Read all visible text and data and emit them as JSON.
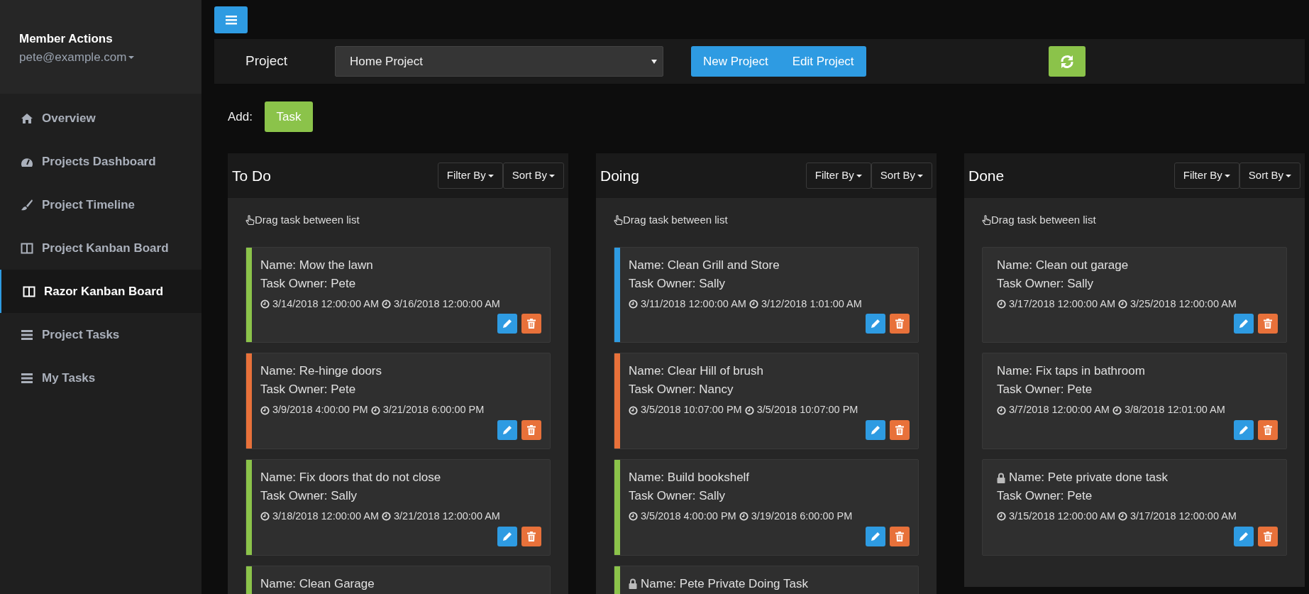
{
  "sidebar": {
    "heading": "Member Actions",
    "user": "pete@example.com",
    "items": [
      {
        "label": "Overview",
        "kind": "home",
        "selected": false
      },
      {
        "label": "Projects Dashboard",
        "kind": "gauge",
        "selected": false
      },
      {
        "label": "Project Timeline",
        "kind": "brush",
        "selected": false
      },
      {
        "label": "Project Kanban Board",
        "kind": "columns",
        "selected": false
      },
      {
        "label": "Razor Kanban Board",
        "kind": "columns",
        "selected": true
      },
      {
        "label": "Project Tasks",
        "kind": "list",
        "selected": false
      },
      {
        "label": "My Tasks",
        "kind": "list",
        "selected": false
      }
    ]
  },
  "project_bar": {
    "label": "Project",
    "select_value": "Home Project",
    "buttons": [
      "New Project",
      "Edit Project"
    ]
  },
  "add": {
    "label": "Add:",
    "button": "Task"
  },
  "columns": [
    {
      "title": "To Do",
      "filter": "Filter By",
      "sort": "Sort By",
      "hint": "Drag task between list",
      "tasks": [
        {
          "name": "Name: Mow the lawn",
          "owner": "Task Owner: Pete",
          "start": "3/14/2018 12:00:00 AM",
          "end": "3/16/2018 12:00:00 AM",
          "color": "#8bc34a",
          "private": false
        },
        {
          "name": "Name: Re-hinge doors",
          "owner": "Task Owner: Pete",
          "start": "3/9/2018 4:00:00 PM",
          "end": "3/21/2018 6:00:00 PM",
          "color": "#e8713a",
          "private": false
        },
        {
          "name": "Name: Fix doors that do not close",
          "owner": "Task Owner: Sally",
          "start": "3/18/2018 12:00:00 AM",
          "end": "3/21/2018 12:00:00 AM",
          "color": "#8bc34a",
          "private": false
        },
        {
          "name": "Name: Clean Garage",
          "color": "#8bc34a",
          "private": false
        }
      ]
    },
    {
      "title": "Doing",
      "filter": "Filter By",
      "sort": "Sort By",
      "hint": "Drag task between list",
      "tasks": [
        {
          "name": "Name: Clean Grill and Store",
          "owner": "Task Owner: Sally",
          "start": "3/11/2018 12:00:00 AM",
          "end": "3/12/2018 1:01:00 AM",
          "color": "#2e9be2",
          "private": false
        },
        {
          "name": "Name: Clear Hill of brush",
          "owner": "Task Owner: Nancy",
          "start": "3/5/2018 10:07:00 PM",
          "end": "3/5/2018 10:07:00 PM",
          "color": "#e8713a",
          "private": false
        },
        {
          "name": "Name: Build bookshelf",
          "owner": "Task Owner: Sally",
          "start": "3/5/2018 4:00:00 PM",
          "end": "3/19/2018 6:00:00 PM",
          "color": "#8bc34a",
          "private": false
        },
        {
          "name": "Name: Pete Private Doing Task",
          "color": "#8bc34a",
          "private": true
        }
      ]
    },
    {
      "title": "Done",
      "filter": "Filter By",
      "sort": "Sort By",
      "hint": "Drag task between list",
      "tasks": [
        {
          "name": "Name: Clean out garage",
          "owner": "Task Owner: Sally",
          "start": "3/17/2018 12:00:00 AM",
          "end": "3/25/2018 12:00:00 AM",
          "private": false
        },
        {
          "name": "Name: Fix taps in bathroom",
          "owner": "Task Owner: Pete",
          "start": "3/7/2018 12:00:00 AM",
          "end": "3/8/2018 12:01:00 AM",
          "private": false
        },
        {
          "name": "Name: Pete private done task",
          "owner": "Task Owner: Pete",
          "start": "3/15/2018 12:00:00 AM",
          "end": "3/17/2018 12:00:00 AM",
          "private": true
        }
      ]
    }
  ]
}
